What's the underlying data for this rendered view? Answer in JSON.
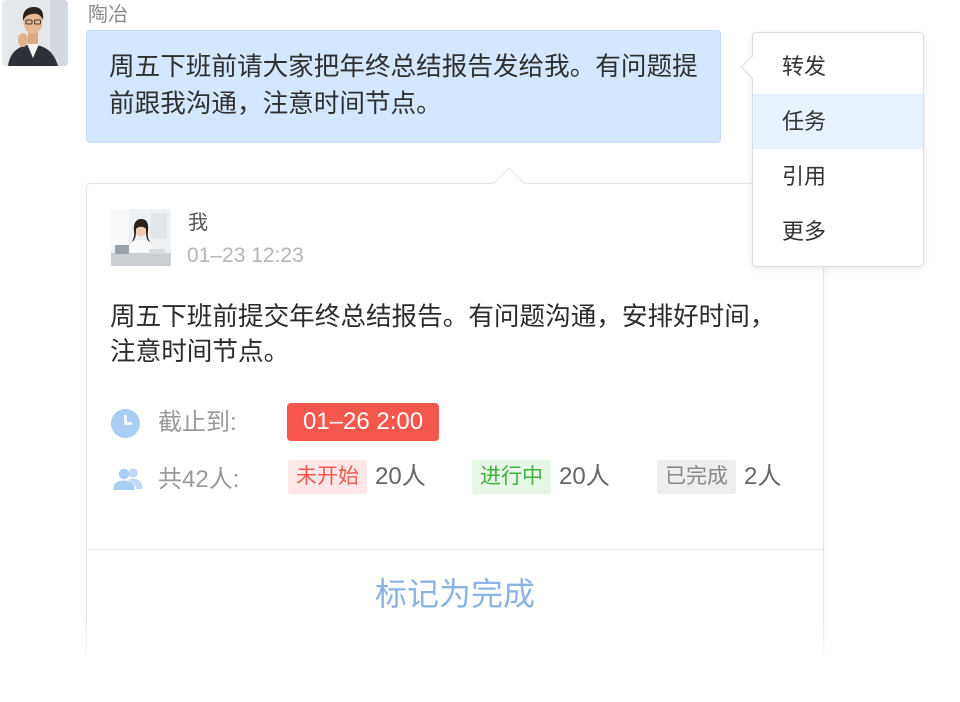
{
  "message": {
    "sender_name": "陶冶",
    "text": "周五下班前请大家把年终总结报告发给我。有问题提前跟我沟通，注意时间节点。"
  },
  "context_menu": {
    "items": [
      {
        "label": "转发",
        "highlighted": false
      },
      {
        "label": "任务",
        "highlighted": true
      },
      {
        "label": "引用",
        "highlighted": false
      },
      {
        "label": "更多",
        "highlighted": false
      }
    ]
  },
  "task_card": {
    "author": "我",
    "timestamp": "01–23 12:23",
    "content": "周五下班前提交年终总结报告。有问题沟通，安排好时间，注意时间节点。",
    "deadline": {
      "icon": "clock-icon",
      "label": "截止到:",
      "value": "01–26 2:00"
    },
    "participants": {
      "icon": "people-icon",
      "label": "共42人:",
      "statuses": [
        {
          "label": "未开始",
          "count": "20人",
          "text_color": "#f0584e",
          "bg_color": "#fde8e7"
        },
        {
          "label": "进行中",
          "count": "20人",
          "text_color": "#3fb23c",
          "bg_color": "#e5f6e4"
        },
        {
          "label": "已完成",
          "count": "2人",
          "text_color": "#888888",
          "bg_color": "#eeeeee"
        }
      ]
    },
    "action_label": "标记为完成"
  },
  "colors": {
    "bubble": "#d5e7fc",
    "menu_highlight": "#e8f2fe",
    "deadline_badge": "#f5574c",
    "action": "#8db3e3",
    "icon": "#a9cdf3"
  }
}
